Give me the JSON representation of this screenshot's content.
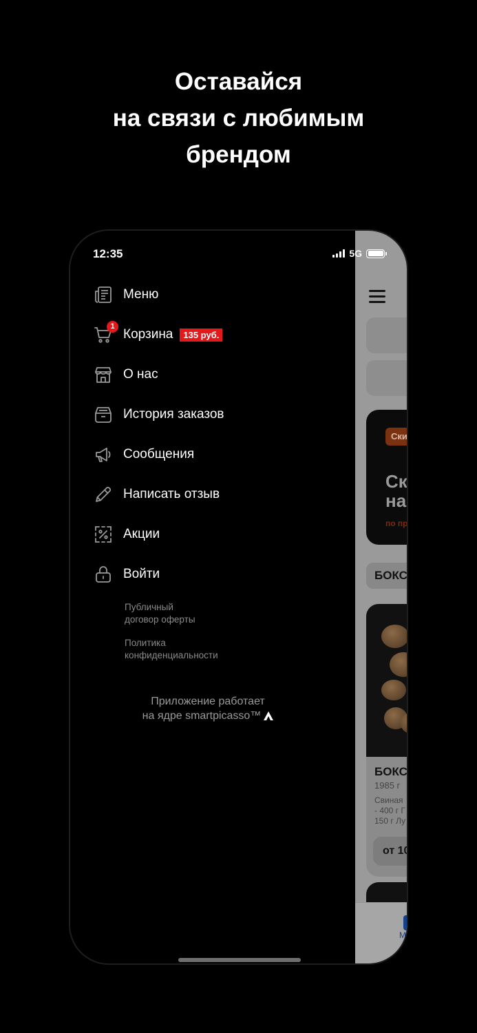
{
  "headline": [
    "Оставайся",
    "на связи с любимым",
    "брендом"
  ],
  "status": {
    "time": "12:35",
    "network": "5G",
    "battery": 1.0
  },
  "menu": [
    {
      "label": "Меню",
      "icon": "menu-book-icon"
    },
    {
      "label": "Корзина",
      "icon": "cart-icon",
      "badge": "1",
      "price": "135 руб."
    },
    {
      "label": "О нас",
      "icon": "store-icon"
    },
    {
      "label": "История заказов",
      "icon": "order-history-icon"
    },
    {
      "label": "Сообщения",
      "icon": "megaphone-icon"
    },
    {
      "label": "Написать отзыв",
      "icon": "pencil-icon"
    },
    {
      "label": "Акции",
      "icon": "discount-icon"
    },
    {
      "label": "Войти",
      "icon": "lock-icon"
    }
  ],
  "legal": {
    "offer": [
      "Публичный",
      "договор оферты"
    ],
    "privacy": [
      "Политика",
      "конфиденциальности"
    ]
  },
  "powered_by": [
    "Приложение работает",
    "на ядре smartpicasso™"
  ],
  "background_app": {
    "banner_chip": "Ски",
    "banner_title": [
      "Ск",
      "на"
    ],
    "banner_sub": "по пр",
    "section": "БОКС",
    "product_title": "БОКС",
    "product_weight": "1985 г",
    "product_desc": [
      "Свиная",
      "- 400 г Г",
      "150 г Лу"
    ],
    "product_price": "от 10",
    "tab_label": "Ме"
  },
  "colors": {
    "accent_red": "#e4191b",
    "tab_blue": "#16408a",
    "background": "#000000"
  }
}
